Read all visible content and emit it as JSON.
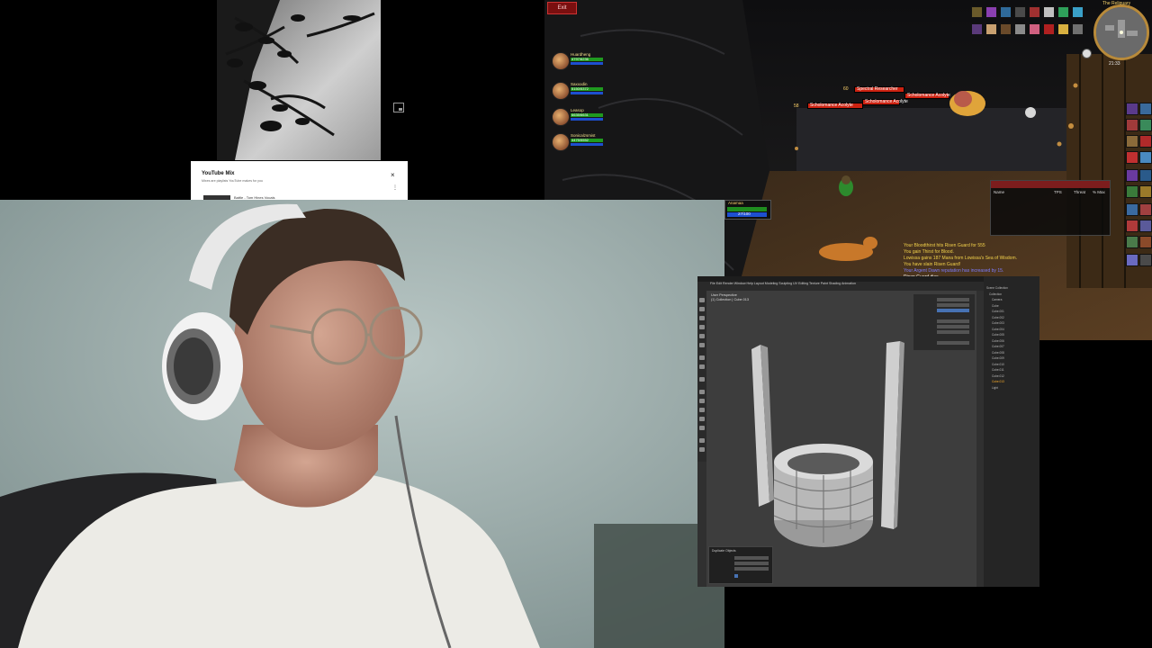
{
  "video_panel": {
    "mix_card": {
      "title": "YouTube Mix",
      "subtitle": "Mixes are playlists YouTube makes for you",
      "close_glyph": "×",
      "more_glyph": "⋮",
      "item_title": "Battle - Tom Hines Vocals"
    },
    "icons": [
      "picture-in-picture-icon"
    ]
  },
  "game": {
    "exit_button": "Exit",
    "party": [
      {
        "name": "Huardheng",
        "hp": "4797/6236"
      },
      {
        "name": "Saxxodin",
        "hp": "5150/5372"
      },
      {
        "name": "Leasop",
        "hp": "6635/6631"
      },
      {
        "name": "Sonicalzsmist",
        "hp": "4475/5552"
      }
    ],
    "nameplates": [
      {
        "level": "60",
        "name": "Spectral Researcher"
      },
      {
        "level": "58",
        "name": "Scholomance Acolyte"
      },
      {
        "level": "",
        "name": "Scholomance Acolyte"
      },
      {
        "level": "",
        "name": "Scholomance Acolyte"
      }
    ],
    "target": {
      "name": "Anamaa",
      "mana": "27/100"
    },
    "minimap": {
      "zone": "The Reliquary",
      "clock": "21:33"
    },
    "threat_meter": {
      "title": "",
      "columns": [
        "Name",
        "TPS",
        "Threat",
        "% Max"
      ]
    },
    "combat_log": [
      {
        "text": "Your Bloodthirst hits Risen Guard for 555",
        "color": "#f2d14b"
      },
      {
        "text": "You gain Thirst for Blood.",
        "color": "#f2d14b"
      },
      {
        "text": "Lowissa gains 187 Mana from Lowissa's Sea of Wisdom.",
        "color": "#f2d14b"
      },
      {
        "text": "You have slain Risen Guard!",
        "color": "#f2d14b"
      },
      {
        "text": "Your Argent Dawn reputation has increased by 15.",
        "color": "#7d7dff"
      },
      {
        "text": "Risen Guard dies.",
        "color": "#ffffff"
      }
    ],
    "colors": {
      "health": "#1f9a1f",
      "mana": "#1d4fd0",
      "hostile": "#cc2211",
      "gold": "#f5d26a"
    }
  },
  "blender": {
    "menu": "File  Edit  Render  Window  Help    Layout  Modeling  Sculpting  UV Editing  Texture Paint  Shading  Animation",
    "view_label": [
      "User Perspective",
      "(1) Collection | Cube.013"
    ],
    "outliner": [
      "Scene Collection",
      "Collection",
      "Camera",
      "Cube",
      "Cube.001",
      "Cube.002",
      "Cube.003",
      "Cube.004",
      "Cube.005",
      "Cube.006",
      "Cube.007",
      "Cube.008",
      "Cube.009",
      "Cube.010",
      "Cube.011",
      "Cube.012",
      "Cube.013",
      "Light"
    ],
    "redo_panel_title": "Duplicate Objects"
  }
}
